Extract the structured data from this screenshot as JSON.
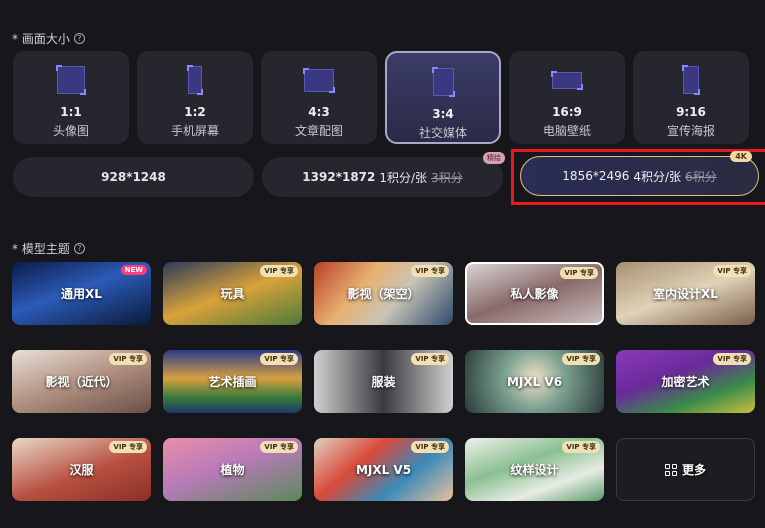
{
  "canvas_size": {
    "title": "* 画面大小",
    "ratios": [
      {
        "value": "1:1",
        "label": "头像图"
      },
      {
        "value": "1:2",
        "label": "手机屏幕"
      },
      {
        "value": "4:3",
        "label": "文章配图"
      },
      {
        "value": "3:4",
        "label": "社交媒体"
      },
      {
        "value": "16:9",
        "label": "电脑壁纸"
      },
      {
        "value": "9:16",
        "label": "宣传海报"
      }
    ],
    "selected_ratio": "3:4"
  },
  "resolution": {
    "options": [
      {
        "size": "928*1248"
      },
      {
        "size": "1392*1872",
        "price": "1积分/张",
        "old_price": "3积分",
        "tag": "精绘"
      },
      {
        "size": "1856*2496",
        "price": "4积分/张",
        "old_price": "6积分",
        "tag": "4K"
      }
    ],
    "selected": "1856*2496"
  },
  "model_theme": {
    "title": "* 模型主题",
    "models": [
      {
        "name": "通用XL",
        "badge": "NEW"
      },
      {
        "name": "玩具",
        "badge": "VIP 专享"
      },
      {
        "name": "影视（架空）",
        "badge": "VIP 专享"
      },
      {
        "name": "私人影像",
        "badge": "VIP 专享"
      },
      {
        "name": "室内设计XL",
        "badge": "VIP 专享"
      },
      {
        "name": "影视（近代）",
        "badge": "VIP 专享"
      },
      {
        "name": "艺术插画",
        "badge": "VIP 专享"
      },
      {
        "name": "服装",
        "badge": "VIP 专享"
      },
      {
        "name": "MJXL V6",
        "badge": "VIP 专享"
      },
      {
        "name": "加密艺术",
        "badge": "VIP 专享"
      },
      {
        "name": "汉服",
        "badge": "VIP 专享"
      },
      {
        "name": "植物",
        "badge": "VIP 专享"
      },
      {
        "name": "MJXL V5",
        "badge": "VIP 专享"
      },
      {
        "name": "纹样设计",
        "badge": "VIP 专享"
      }
    ],
    "selected": "私人影像",
    "more_label": "更多"
  }
}
